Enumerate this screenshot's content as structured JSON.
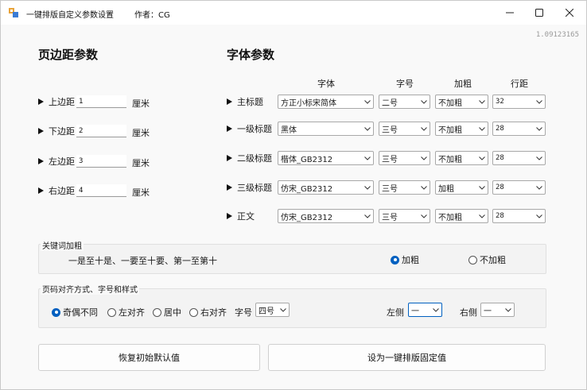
{
  "window": {
    "title": "一键排版自定义参数设置",
    "author": "作者：CG",
    "version": "1.09123165",
    "controls": {
      "minimize": "—",
      "maximize": "☐",
      "close": "✕"
    }
  },
  "margins": {
    "title": "页边距参数",
    "unit": "厘米",
    "rows": [
      {
        "label": "上边距",
        "value": "1"
      },
      {
        "label": "下边距",
        "value": "2"
      },
      {
        "label": "左边距",
        "value": "3"
      },
      {
        "label": "右边距",
        "value": "4"
      }
    ]
  },
  "fonts": {
    "title": "字体参数",
    "headers": {
      "font": "字体",
      "size": "字号",
      "bold": "加粗",
      "spacing": "行距"
    },
    "rows": [
      {
        "label": "主标题",
        "font": "方正小标宋简体",
        "size": "二号",
        "bold": "不加粗",
        "spacing": "32"
      },
      {
        "label": "一级标题",
        "font": "黑体",
        "size": "三号",
        "bold": "不加粗",
        "spacing": "28"
      },
      {
        "label": "二级标题",
        "font": "楷体_GB2312",
        "size": "三号",
        "bold": "不加粗",
        "spacing": "28"
      },
      {
        "label": "三级标题",
        "font": "仿宋_GB2312",
        "size": "三号",
        "bold": "加粗",
        "spacing": "28"
      },
      {
        "label": "正文",
        "font": "仿宋_GB2312",
        "size": "三号",
        "bold": "不加粗",
        "spacing": "28"
      }
    ]
  },
  "keywords": {
    "label": "关键词加粗",
    "text": "一是至十是、一要至十要、第一至第十",
    "bold_option": "加粗",
    "no_bold_option": "不加粗",
    "selected": "bold"
  },
  "page_numbers": {
    "label": "页码对齐方式、字号和样式",
    "options": [
      "奇偶不同",
      "左对齐",
      "居中",
      "右对齐"
    ],
    "selected_index": 0,
    "size_label": "字号",
    "size_value": "四号",
    "left_label": "左侧",
    "left_value": "一",
    "right_label": "右侧",
    "right_value": "一"
  },
  "buttons": {
    "restore": "恢复初始默认值",
    "set_fixed": "设为一键排版固定值"
  },
  "colors": {
    "accent": "#0060c0",
    "window_bg": "#f9f9f9",
    "group_bg": "#f3f3f3"
  }
}
